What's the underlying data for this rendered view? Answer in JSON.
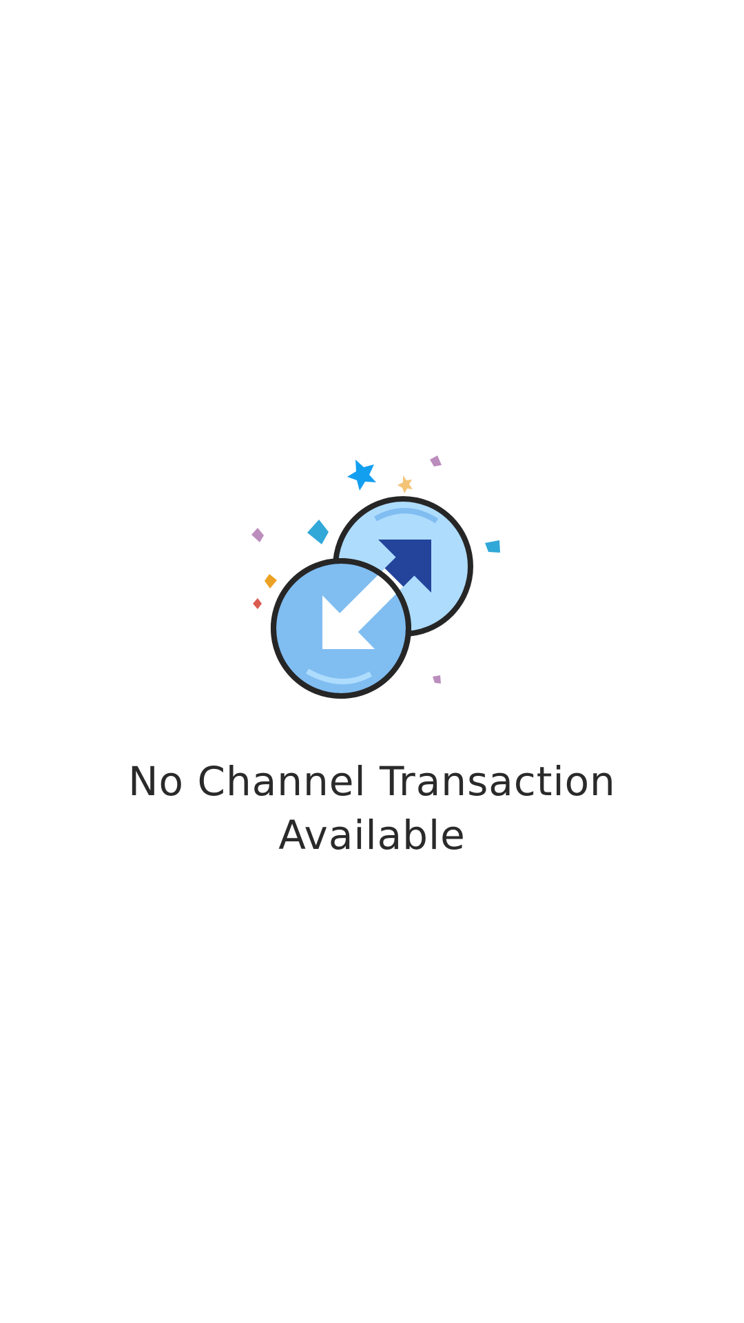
{
  "empty_state": {
    "message_line1": "No Channel Transaction",
    "message_line2": "Available",
    "icon": "exchange-coins-icon"
  },
  "colors": {
    "back_coin": "#aedcfd",
    "front_coin": "#80bdf1",
    "outline": "#262626",
    "dark_arrow": "#23449a",
    "text": "#2a2a2a"
  }
}
